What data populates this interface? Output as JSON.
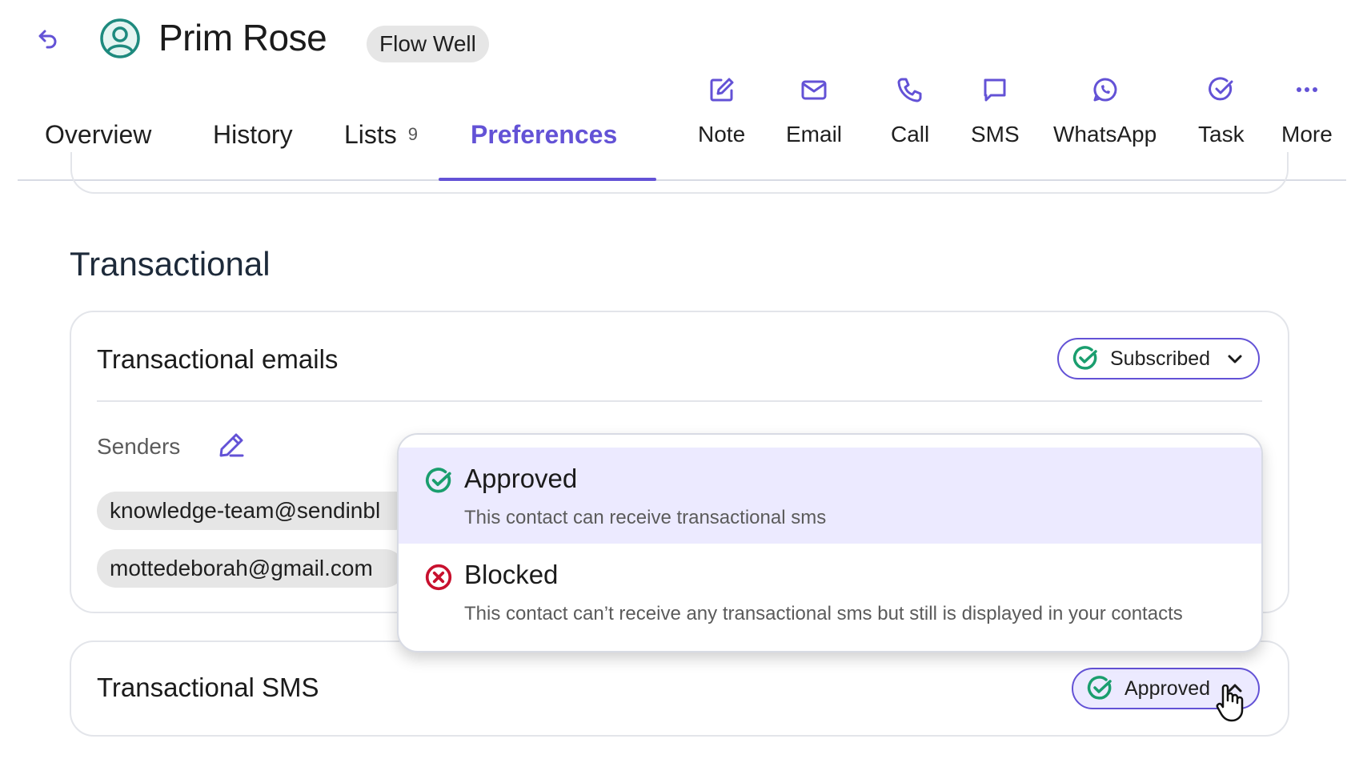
{
  "header": {
    "contact_name": "Prim Rose",
    "company_badge": "Flow Well"
  },
  "tabs": [
    {
      "label": "Overview"
    },
    {
      "label": "History"
    },
    {
      "label": "Lists",
      "count": "9"
    },
    {
      "label": "Preferences",
      "active": true
    }
  ],
  "actions": [
    {
      "label": "Note",
      "icon": "note-edit-icon"
    },
    {
      "label": "Email",
      "icon": "email-icon"
    },
    {
      "label": "Call",
      "icon": "phone-icon"
    },
    {
      "label": "SMS",
      "icon": "sms-icon"
    },
    {
      "label": "WhatsApp",
      "icon": "whatsapp-icon"
    },
    {
      "label": "Task",
      "icon": "task-check-icon"
    },
    {
      "label": "More",
      "icon": "more-dots-icon"
    }
  ],
  "section": {
    "title": "Transactional"
  },
  "transactional_emails": {
    "title": "Transactional emails",
    "status": "Subscribed",
    "senders_label": "Senders",
    "senders": [
      "knowledge-team@sendinbl",
      "mottedeborah@gmail.com"
    ]
  },
  "transactional_sms": {
    "title": "Transactional SMS",
    "status": "Approved"
  },
  "dropdown": {
    "options": [
      {
        "title": "Approved",
        "description": "This contact can receive transactional sms",
        "selected": true
      },
      {
        "title": "Blocked",
        "description": "This contact can’t receive any transactional sms but still is displayed in your contacts"
      }
    ]
  },
  "colors": {
    "accent": "#6352d6",
    "success": "#1a9e6e",
    "danger": "#c8102e",
    "avatar": "#1e8a7e"
  }
}
